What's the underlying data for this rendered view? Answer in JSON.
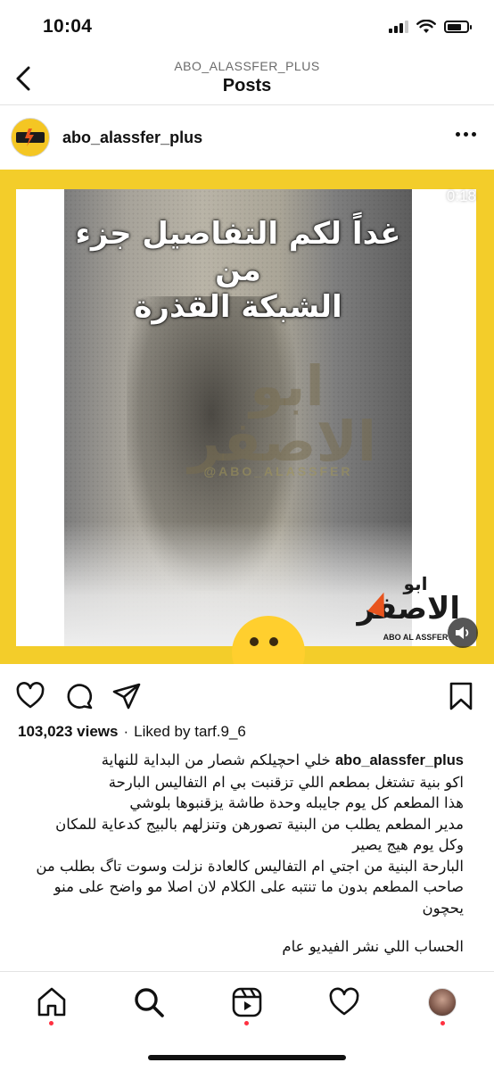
{
  "status_bar": {
    "time": "10:04"
  },
  "header": {
    "account": "ABO_ALASSFER_PLUS",
    "title": "Posts"
  },
  "post": {
    "username": "abo_alassfer_plus",
    "video": {
      "duration": "0:18",
      "overlay_text_line1": "غداً لكم التفاصيل جزء من",
      "overlay_text_line2": "الشبكة القذرة",
      "watermark_line1": "ابو",
      "watermark_line2": "الاصفر",
      "watermark_handle": "@ABO_ALASSFER",
      "logo_line1": "ابو",
      "logo_line2": "الاصفر",
      "logo_line3": "ABO AL ASSFER"
    },
    "views": "103,023 views",
    "separator": "·",
    "liked_by_label": "Liked by",
    "liked_by_user": "tarf.9_6",
    "caption_lines": [
      "خلي  احچيلكم شصار من البداية للنهاية",
      "اكو بنية تشتغل بمطعم  اللي تزقنبت بي ام التفاليس البارحة",
      "هذا المطعم كل يوم جايبله وحدة طاشة يزقنبوها بلوشي",
      "مدير المطعم يطلب من البنية تصورهن وتنزلهم بالبيج كدعاية للمكان",
      "وكل يوم هيج يصير",
      "البارحة البنية من اجتي ام التفاليس كالعادة نزلت وسوت تاگ بطلب من",
      "صاحب المطعم بدون ما تنتبه على الكلام لان اصلا مو واضح على منو",
      "يحچون",
      "الحساب اللي نشر الفيديو عام"
    ]
  },
  "colors": {
    "brand_yellow": "#f3cd2a",
    "notification_dot": "#ff3040"
  },
  "tabs": [
    "home-tab",
    "search-tab",
    "reels-tab",
    "activity-tab",
    "profile-tab"
  ]
}
